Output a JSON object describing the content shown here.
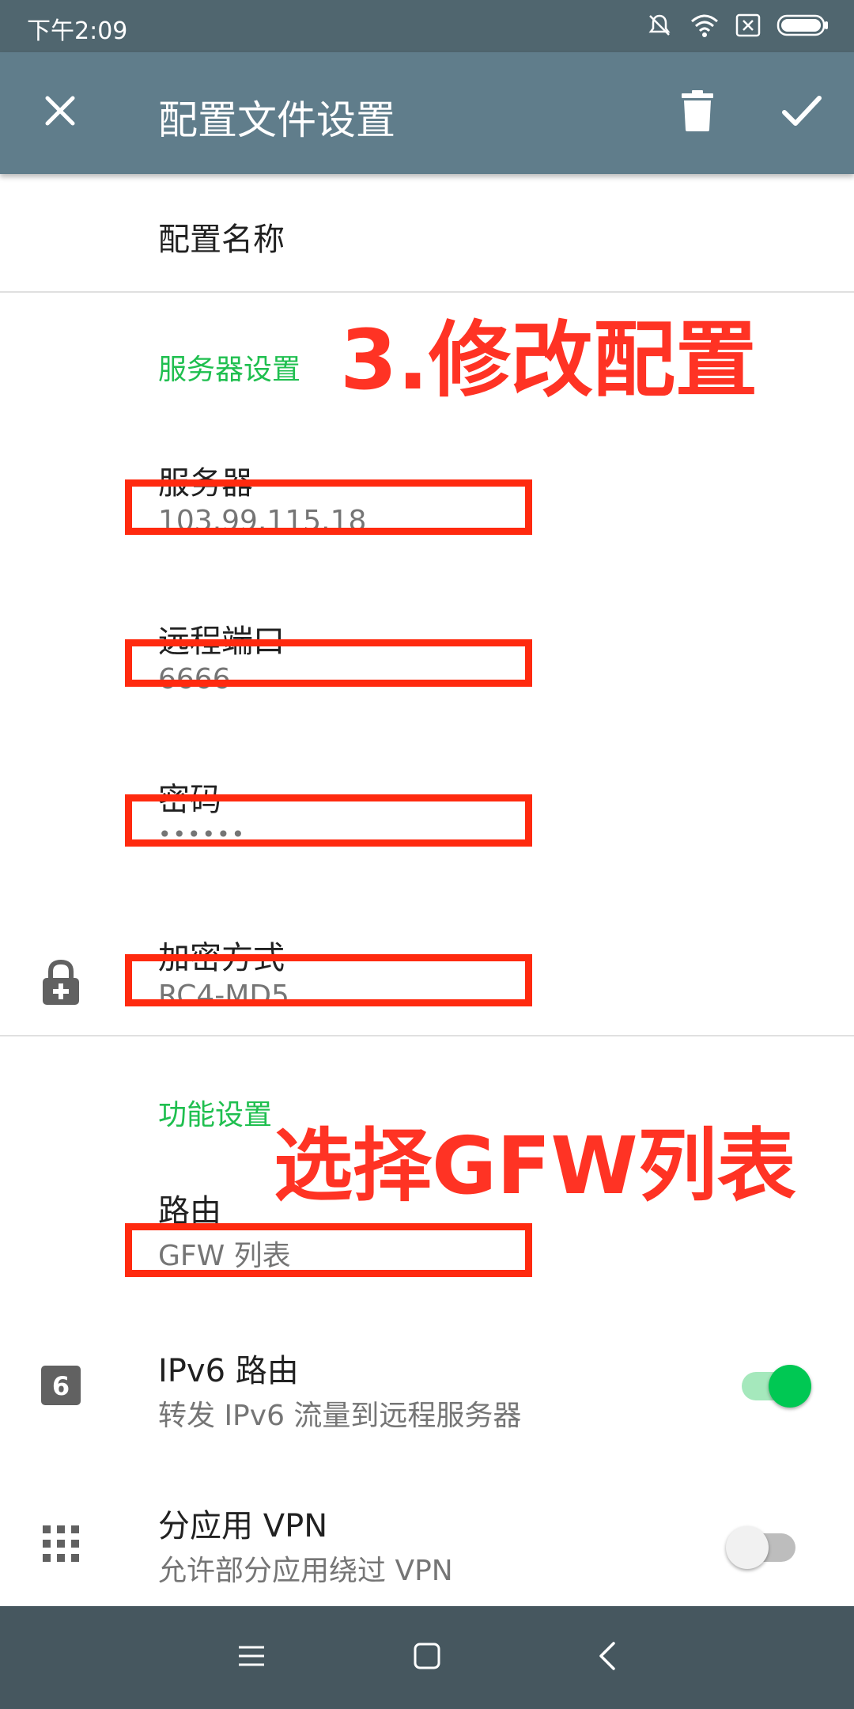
{
  "status_bar": {
    "time": "下午2:09",
    "icons": [
      "mute-icon",
      "wifi-icon",
      "no-sim-icon",
      "battery-icon"
    ]
  },
  "app_bar": {
    "title": "配置文件设置",
    "close_icon": "close-icon",
    "delete_icon": "delete-icon",
    "confirm_icon": "check-icon",
    "background": "#607d8b"
  },
  "profile": {
    "name_label": "配置名称"
  },
  "server_section": {
    "title": "服务器设置",
    "server_label": "服务器",
    "server_value": "103.99.115.18",
    "port_label": "远程端口",
    "port_value": "6666",
    "password_label": "密码",
    "password_value": "••••••",
    "method_label": "加密方式",
    "method_value": "RC4-MD5"
  },
  "feature_section": {
    "title": "功能设置",
    "route_label": "路由",
    "route_value": "GFW 列表",
    "ipv6_title": "IPv6 路由",
    "ipv6_subtitle": "转发 IPv6 流量到远程服务器",
    "ipv6_enabled": true,
    "per_app_title": "分应用 VPN",
    "per_app_subtitle": "允许部分应用绕过 VPN",
    "per_app_enabled": false
  },
  "annotations": {
    "step3": "3.修改配置",
    "gfw": "选择GFW列表",
    "color": "#ff2a0f"
  },
  "nav_bar": {
    "icons": [
      "menu-icon",
      "home-icon",
      "back-icon"
    ]
  },
  "colors": {
    "accent": "#1fbf4f",
    "status_bar": "#50666f",
    "nav_bar": "#46575f"
  }
}
